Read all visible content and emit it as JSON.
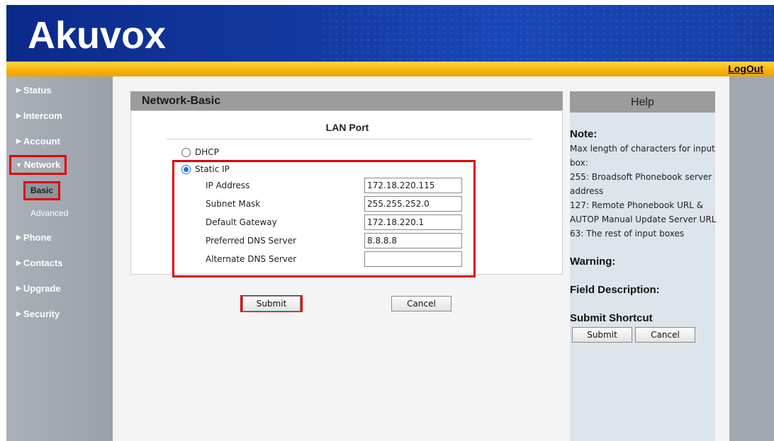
{
  "header": {
    "logo_text": "Akuvox",
    "logout_label": "LogOut"
  },
  "sidebar": {
    "items": [
      {
        "label": "Status"
      },
      {
        "label": "Intercom"
      },
      {
        "label": "Account"
      },
      {
        "label": "Network"
      },
      {
        "label": "Phone"
      },
      {
        "label": "Contacts"
      },
      {
        "label": "Upgrade"
      },
      {
        "label": "Security"
      }
    ],
    "network_sub": [
      {
        "label": "Basic"
      },
      {
        "label": "Advanced"
      }
    ],
    "arrow_collapsed": "▶",
    "arrow_expanded": "▼"
  },
  "main": {
    "panel_title": "Network-Basic",
    "section_title": "LAN Port",
    "dhcp_label": "DHCP",
    "static_label": "Static IP",
    "selected_mode": "Static IP",
    "fields": [
      {
        "label": "IP Address",
        "value": "172.18.220.115"
      },
      {
        "label": "Subnet Mask",
        "value": "255.255.252.0"
      },
      {
        "label": "Default Gateway",
        "value": "172.18.220.1"
      },
      {
        "label": "Preferred DNS Server",
        "value": "8.8.8.8"
      },
      {
        "label": "Alternate DNS Server",
        "value": ""
      }
    ],
    "submit_label": "Submit",
    "cancel_label": "Cancel"
  },
  "help": {
    "title": "Help",
    "note_heading": "Note:",
    "note_lines": [
      "Max length of characters for input",
      "box:",
      "255: Broadsoft Phonebook server",
      "address",
      "127: Remote Phonebook URL &",
      "AUTOP Manual Update Server URL",
      "63: The rest of input boxes"
    ],
    "warning_heading": "Warning:",
    "field_desc_heading": "Field Description:",
    "shortcut_heading": "Submit Shortcut",
    "shortcut_submit": "Submit",
    "shortcut_cancel": "Cancel"
  },
  "colors": {
    "header_blue": "#12389e",
    "orange_bar": "#f6b40a",
    "sidebar_gray": "#9aa1aa",
    "highlight_red": "#e00000",
    "radio_blue": "#1a73e8"
  }
}
